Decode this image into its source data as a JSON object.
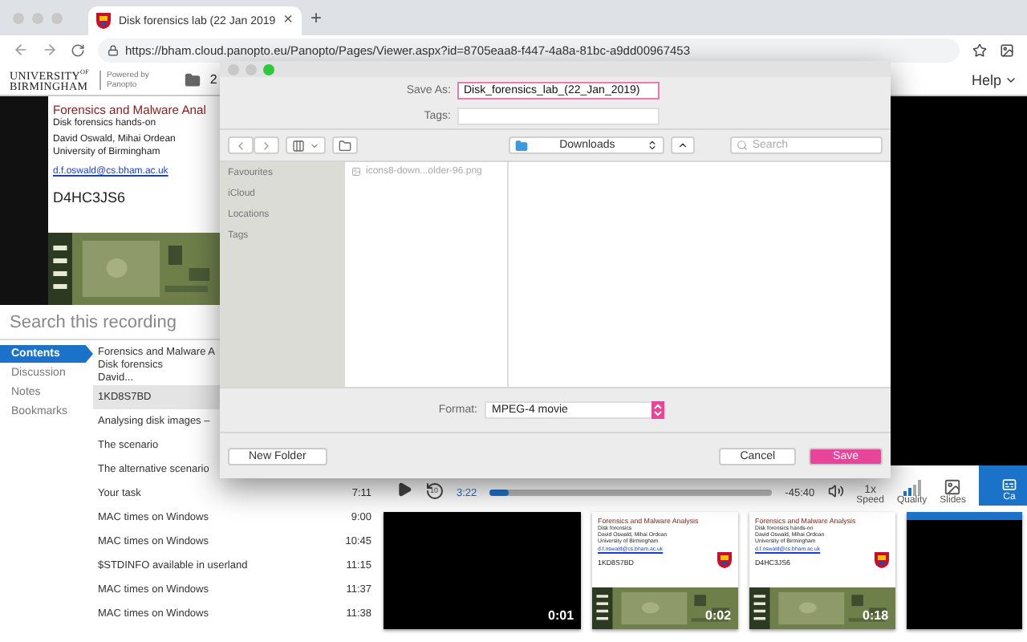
{
  "browser": {
    "tab": {
      "title": "Disk forensics lab (22 Jan 2019",
      "close": "×"
    },
    "new_tab": "+",
    "url": "https://bham.cloud.panopto.eu/Panopto/Pages/Viewer.aspx?id=8705eaa8-f447-4a8a-81bc-a9dd00967453"
  },
  "header": {
    "logo_top": "UNIVERSITY",
    "logo_of": "OF",
    "logo_bottom": "BIRMINGHAM",
    "powered": "Powered by",
    "powered_brand": "Panopto",
    "folder": "2",
    "help": "Help"
  },
  "slide": {
    "title": "Forensics and Malware Anal",
    "subtitle": "Disk forensics hands-on",
    "authors": "David Oswald, Mihai Ordean",
    "affiliation": "University of Birmingham",
    "email": "d.f.oswald@cs.bham.ac.uk",
    "code": "D4HC3JS6"
  },
  "search": {
    "placeholder": "Search this recording"
  },
  "nav": [
    {
      "label": "Contents",
      "selected": true
    },
    {
      "label": "Discussion",
      "selected": false
    },
    {
      "label": "Notes",
      "selected": false
    },
    {
      "label": "Bookmarks",
      "selected": false
    }
  ],
  "contents": [
    {
      "lines": [
        "Forensics and Malware A",
        "Disk forensics",
        "David..."
      ],
      "selected": false
    },
    {
      "lines": [
        "1KD8S7BD"
      ],
      "selected": true
    },
    {
      "lines": [
        "Analysing disk images –"
      ],
      "selected": false
    },
    {
      "lines": [
        "The scenario"
      ],
      "selected": false
    },
    {
      "lines": [
        "The alternative scenario"
      ],
      "selected": false
    },
    {
      "lines": [
        "Your task"
      ],
      "time": "7:11",
      "selected": false
    },
    {
      "lines": [
        "MAC times on Windows"
      ],
      "time": "9:00",
      "selected": false
    },
    {
      "lines": [
        "MAC times on Windows"
      ],
      "time": "10:45",
      "selected": false
    },
    {
      "lines": [
        "$STDINFO available in userland"
      ],
      "time": "11:15",
      "selected": false
    },
    {
      "lines": [
        "MAC times on Windows"
      ],
      "time": "11:37",
      "selected": false
    },
    {
      "lines": [
        "MAC times on Windows"
      ],
      "time": "11:38",
      "selected": false
    }
  ],
  "dialog": {
    "save_as_label": "Save As:",
    "filename": "Disk_forensics_lab_(22_Jan_2019)",
    "tags_label": "Tags:",
    "location": "Downloads",
    "search_placeholder": "Search",
    "sidebar": [
      "Favourites",
      "iCloud",
      "Locations",
      "Tags"
    ],
    "files": [
      {
        "name": "icons8-down...older-96.png",
        "disabled": true
      }
    ],
    "format_label": "Format:",
    "format": "MPEG-4 movie",
    "new_folder": "New Folder",
    "cancel": "Cancel",
    "save": "Save"
  },
  "player": {
    "elapsed": "3:22",
    "level": 0.07,
    "remaining": "-45:40",
    "rewind": "10",
    "speed": "1x",
    "speed_label": "Speed",
    "quality": "Quality",
    "slides": "Slides",
    "captions": "Ca"
  },
  "thumbnails": [
    {
      "kind": "black",
      "time": "0:01",
      "selected": false
    },
    {
      "kind": "slide",
      "title": "Forensics and Malware Analysis",
      "subtitle": "Disk forensics",
      "authors": "David Oswald, Mihai Ordean",
      "affiliation": "University of Birmingham",
      "email": "d.f.oswald@cs.bham.ac.uk",
      "code": "1KD8S7BD",
      "time": "0:02",
      "selected": false
    },
    {
      "kind": "slide",
      "title": "Forensics and Malware Analysis",
      "subtitle": "Disk forensics hands-on",
      "authors": "David Oswald, Mihai Ordean",
      "affiliation": "University of Birmingham",
      "email": "d.f.oswald@cs.bham.ac.uk",
      "code": "D4HC3JS6",
      "time": "0:18",
      "selected": false
    },
    {
      "kind": "black",
      "selected": true
    }
  ]
}
